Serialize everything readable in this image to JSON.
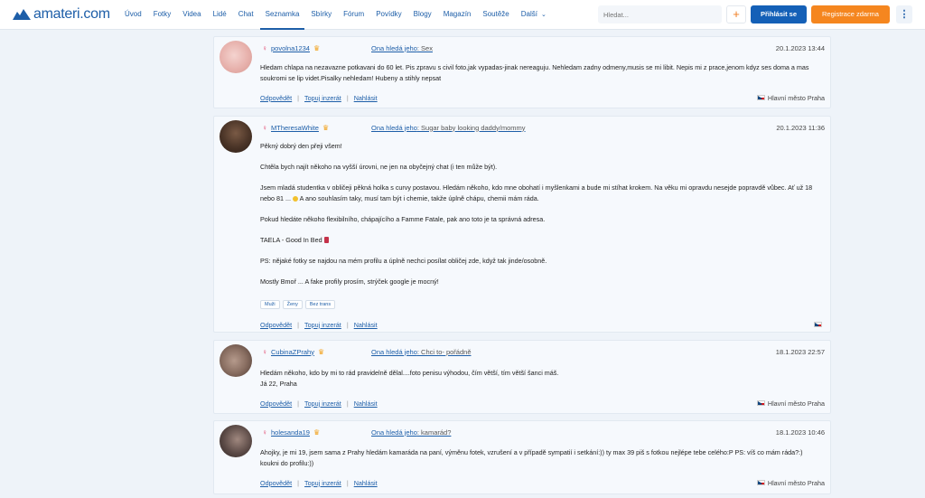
{
  "header": {
    "logo_text": "amateri.com",
    "nav": [
      "Úvod",
      "Fotky",
      "Videa",
      "Lidé",
      "Chat",
      "Seznamka",
      "Sbírky",
      "Fórum",
      "Povídky",
      "Blogy",
      "Magazín",
      "Soutěže",
      "Další"
    ],
    "active_nav": "Seznamka",
    "search_placeholder": "Hledat...",
    "plus_label": "+",
    "login_label": "Přihlásit se",
    "register_label": "Registrace zdarma",
    "menu_label": "⋮"
  },
  "common": {
    "looking_for_label": "Ona hledá jeho",
    "reply": "Odpovědět",
    "top": "Topuj inzerát",
    "report": "Nahlásit",
    "separator": "|"
  },
  "ads": [
    {
      "user": "povolna1234",
      "looking_for": ": Sex",
      "date": "20.1.2023 13:44",
      "paragraphs": [
        "Hledam chlapa na nezavazne potkavani do 60 let. Pis zpravu s civil foto,jak vypadas-jinak nereaguju. Nehledam zadny odmeny,musis se mi libit. Nepis mi z prace,jenom kdyz ses doma a mas soukromi se lip videt.Pisalky nehledam! Hubeny a stihly nepsat"
      ],
      "location": "Hlavní město Praha",
      "avatar_color": "#e9b7b4"
    },
    {
      "user": "MTheresaWhite",
      "looking_for": ": Sugar baby looking daddy/mommy",
      "date": "20.1.2023 11:36",
      "paragraphs": [
        "Pěkný dobrý den přeji všem!",
        "Chtěla bych najít někoho na vyšší úrovni, ne jen na obyčejný chat (i ten může být).",
        "Jsem mladá studentka v obličeji pěkná holka s curvy postavou. Hledám někoho, kdo mne obohatí i myšlenkami a bude mi stíhat krokem. Na věku mi opravdu nesejde popravdě vůbec. Ať už 18 nebo 81 ...",
        " A ano souhlasím taky, musí tam být i chemie, takže úplně chápu, chemii mám ráda.",
        "Pokud hledáte někoho flexibilního, chápajícího a Famme Fatale, pak ano toto je ta správná adresa.",
        "TAELA - Good In Bed",
        "PS: nějaké fotky se najdou na mém profilu a úplně nechci posílat obličej zde, když tak jinde/osobně.",
        "Mostly Bmoř ... A fake profily prosím, strýček google je mocný!"
      ],
      "tags": [
        "Muži",
        "Ženy",
        "Bez trans"
      ],
      "location": "",
      "avatar_color": "#4a3427"
    },
    {
      "user": "CubinaZPrahy",
      "looking_for": ": Chci to- pořádně",
      "date": "18.1.2023 22:57",
      "paragraphs": [
        "Hledám někoho, kdo by mi to rád pravidelně dělal....foto penisu výhodou, čím větší, tím větší šanci máš.",
        "Já 22, Praha"
      ],
      "location": "Hlavní město Praha",
      "avatar_color": "#8a6f62"
    },
    {
      "user": "holesanda19",
      "looking_for": ": kamarád?",
      "date": "18.1.2023 10:46",
      "paragraphs": [
        "Ahojky, je mi 19, jsem sama z Prahy hledám kamaráda na paní, výměnu fotek, vzrušení a v případě sympatií i setkání:)) ty max 39 piš s fotkou nejlépe tebe celého:P PS: víš co mám ráda?:) koukni do profilu:))"
      ],
      "location": "Hlavní město Praha",
      "avatar_color": "#5b4a46"
    }
  ]
}
